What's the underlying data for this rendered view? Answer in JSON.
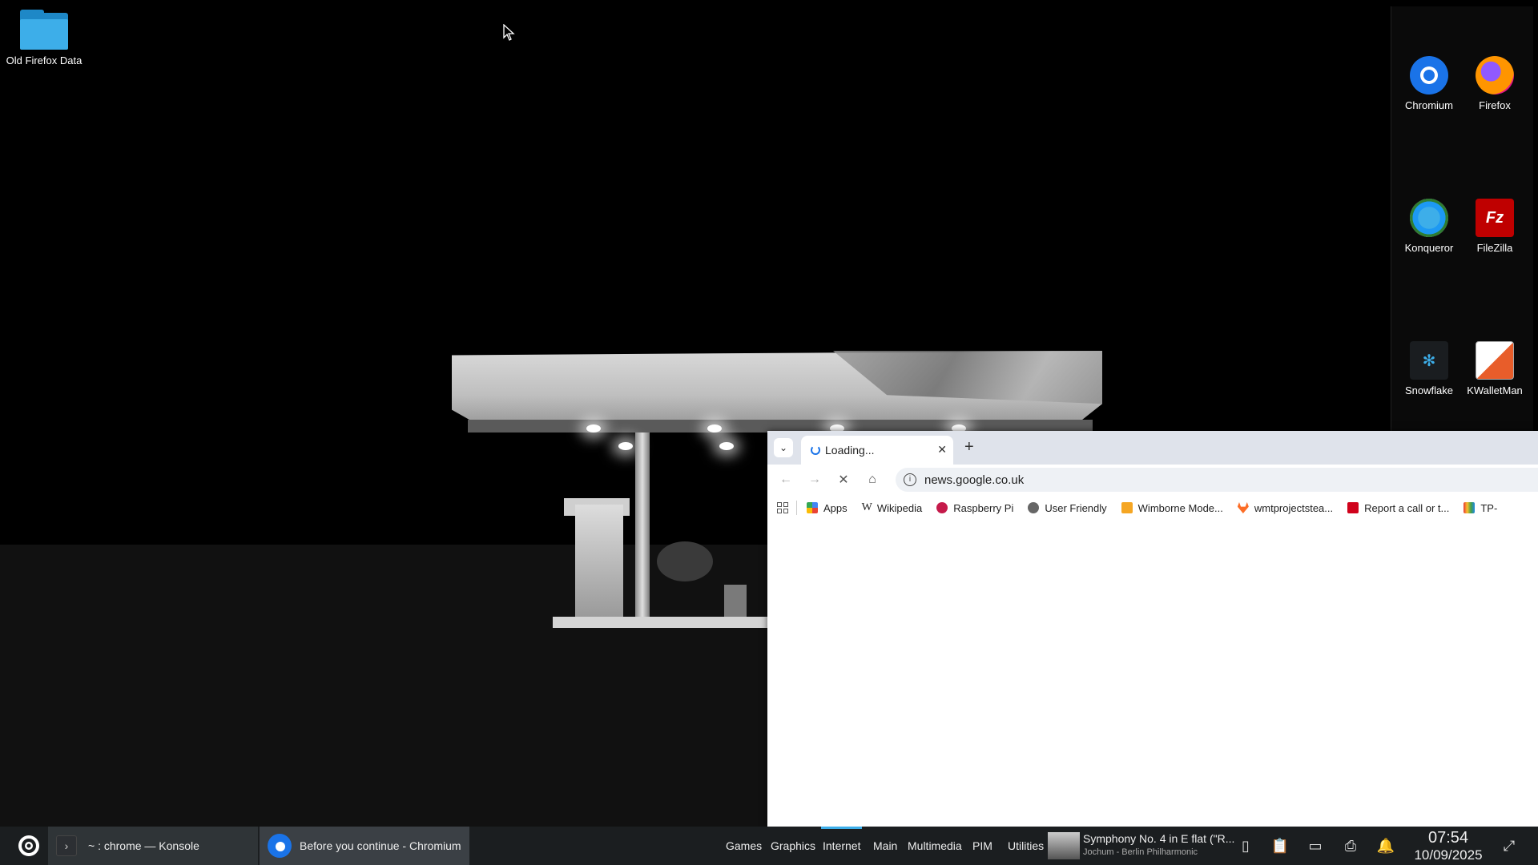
{
  "desktop": {
    "icons": [
      {
        "label": "Old Firefox Data",
        "icon": "folder-icon"
      }
    ]
  },
  "app_panel": {
    "apps": [
      {
        "label": "Chromium",
        "icon": "chromium-icon"
      },
      {
        "label": "Firefox",
        "icon": "firefox-icon"
      },
      {
        "label": "Konqueror",
        "icon": "konqueror-icon"
      },
      {
        "label": "FileZilla",
        "icon": "filezilla-icon"
      },
      {
        "label": "Snowflake",
        "icon": "snowflake-icon"
      },
      {
        "label": "KWalletMan",
        "icon": "kwallet-icon"
      }
    ]
  },
  "browser": {
    "tab_title": "Loading...",
    "url": "news.google.co.uk",
    "bookmarks": [
      {
        "label": "Apps",
        "color": "#4285f4"
      },
      {
        "label": "Wikipedia",
        "color": "#000000"
      },
      {
        "label": "Raspberry Pi",
        "color": "#c51a4a"
      },
      {
        "label": "User Friendly",
        "color": "#444444"
      },
      {
        "label": "Wimborne Mode...",
        "color": "#f5a623"
      },
      {
        "label": "wmtprojectstea...",
        "color": "#fc6d26"
      },
      {
        "label": "Report a call or t...",
        "color": "#d0021b"
      },
      {
        "label": "TP-",
        "color": "#333333"
      }
    ]
  },
  "taskbar": {
    "tasks": [
      {
        "label": "~ : chrome — Konsole"
      },
      {
        "label": "Before you continue - Chromium"
      }
    ],
    "menu": [
      "Games",
      "Graphics",
      "Internet",
      "Main",
      "Multimedia",
      "PIM",
      "Utilities"
    ],
    "selected_menu": "Internet",
    "media": {
      "title": "Symphony No. 4 in E flat (\"R...",
      "artist": "Jochum - Berlin Philharmonic"
    },
    "clock": {
      "time": "07:54",
      "date": "10/09/2025"
    }
  },
  "colors": {
    "accent": "#3daee9",
    "taskbar": "#1b1e20",
    "tabbar": "#dfe3eb"
  }
}
